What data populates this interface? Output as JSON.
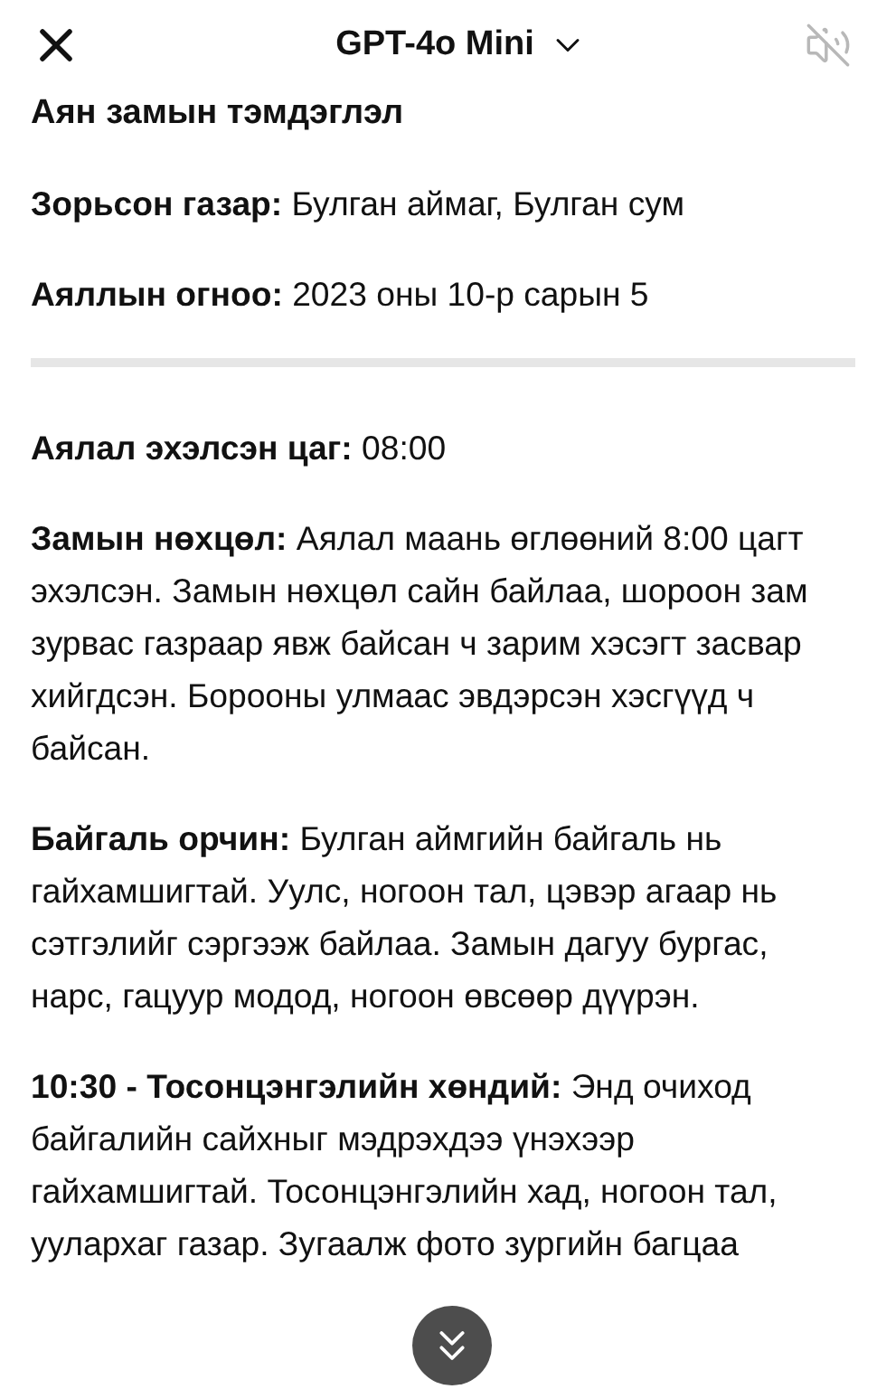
{
  "header": {
    "title": "GPT-4o Mini",
    "sound_muted": true
  },
  "content": [
    {
      "kind": "heading",
      "text": "Аян замын тэмдэглэл"
    },
    {
      "kind": "paragraph",
      "text": "**Зорьсон газар:** Булган аймаг, Булган сум"
    },
    {
      "kind": "paragraph",
      "text": "**Аяллын огноо:** 2023 оны 10-р сарын 5"
    },
    {
      "kind": "divider"
    },
    {
      "kind": "paragraph",
      "text": "**Аялал эхэлсэн цаг:** 08:00"
    },
    {
      "kind": "paragraph",
      "text": "**Замын нөхцөл:** Аялал маань өглөөний 8:00 цагт эхэлсэн. Замын нөхцөл сайн байлаа, шороон зам зурвас газраар явж байсан ч зарим хэсэгт засвар хийгдсэн. Борооны улмаас эвдэрсэн хэсгүүд ч байсан."
    },
    {
      "kind": "paragraph",
      "text": "**Байгаль орчин:** Булган аймгийн байгаль нь гайхамшигтай. Уулс, ногоон тал, цэвэр агаар нь сэтгэлийг сэргээж байлаа. Замын дагуу бургас, нарс, гацуур модод, ногоон өвсөөр дүүрэн."
    },
    {
      "kind": "paragraph",
      "text": "**10:30 - Тосонцэнгэлийн хөндий:** Энд очиход байгалийн сайхныг мэдрэхдээ үнэхээр гайхамшигтай. Тосонцэнгэлийн хад, ногоон тал, уулархаг газар. Зугаалж фото зургийн багцаа"
    }
  ]
}
